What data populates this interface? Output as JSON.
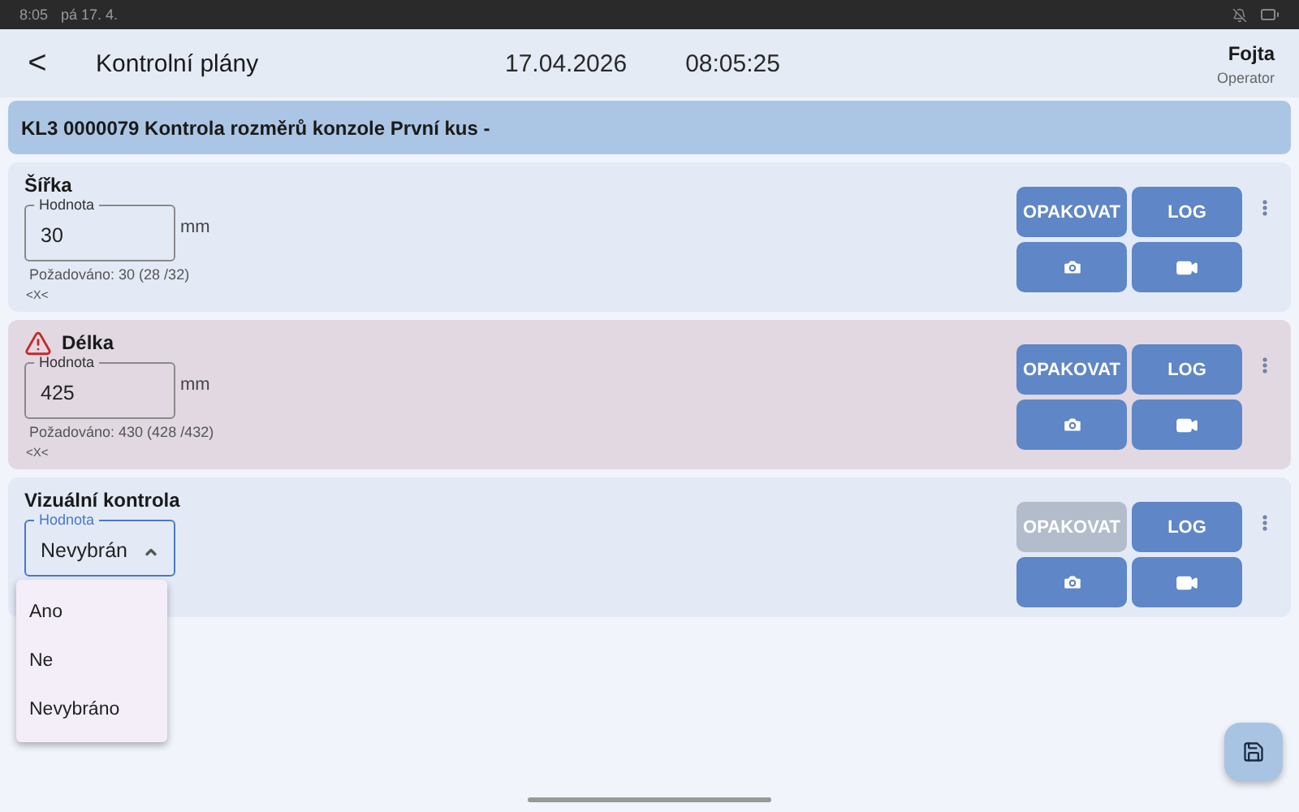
{
  "status_bar": {
    "time": "8:05",
    "date": "pá 17. 4."
  },
  "header": {
    "back": "<",
    "title": "Kontrolní plány",
    "date": "17.04.2026",
    "time": "08:05:25",
    "user": "Fojta",
    "role": "Operator"
  },
  "banner": "KL3 0000079 Kontrola rozměrů konzole První kus  -",
  "checks": [
    {
      "kind": "numeric",
      "title": "Šířka",
      "warning": false,
      "field_label": "Hodnota",
      "value": "30",
      "unit": "mm",
      "required": "Požadováno: 30  (28 /32)",
      "note": "<X<",
      "buttons": {
        "repeat": "OPAKOVAT",
        "repeat_disabled": false,
        "log": "LOG"
      }
    },
    {
      "kind": "numeric",
      "title": "Délka",
      "warning": true,
      "field_label": "Hodnota",
      "value": "425",
      "unit": "mm",
      "required": "Požadováno: 430  (428 /432)",
      "note": "<X<",
      "buttons": {
        "repeat": "OPAKOVAT",
        "repeat_disabled": false,
        "log": "LOG"
      }
    },
    {
      "kind": "select",
      "title": "Vizuální kontrola",
      "warning": false,
      "field_label": "Hodnota",
      "value": "Nevybrán",
      "open": true,
      "options": [
        "Ano",
        "Ne",
        "Nevybráno"
      ],
      "buttons": {
        "repeat": "OPAKOVAT",
        "repeat_disabled": true,
        "log": "LOG"
      }
    }
  ]
}
